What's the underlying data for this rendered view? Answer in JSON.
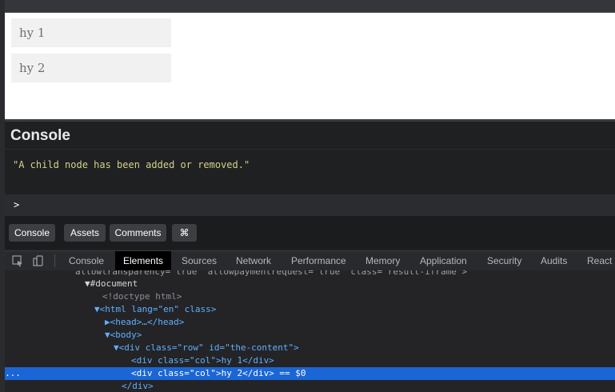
{
  "preview": {
    "cols": [
      "hy 1",
      "hy 2"
    ]
  },
  "console": {
    "title": "Console",
    "message": "\"A child node has been added or removed.\"",
    "prompt": ">"
  },
  "buttons": {
    "console": "Console",
    "assets": "Assets",
    "comments": "Comments",
    "cmd": "⌘"
  },
  "devtools": {
    "tabs": [
      "Console",
      "Elements",
      "Sources",
      "Network",
      "Performance",
      "Memory",
      "Application",
      "Security",
      "Audits",
      "React"
    ],
    "active_tab": "Elements"
  },
  "elements_tree": {
    "line0": "allowtransparency=\"true\" allowpaymentrequest=\"true\" class=\"result-iframe\">",
    "document": "▼#document",
    "doctype": "<!doctype html>",
    "html_open": "▼<html lang=\"en\" class>",
    "head": "▶<head>…</head>",
    "body_open": "▼<body>",
    "div_row": "▼<div class=\"row\" id=\"the-content\">",
    "col1": "<div class=\"col\">hy 1</div>",
    "col2": "<div class=\"col\">hy 2</div> == $0",
    "div_close": "</div>",
    "gutter_dots": "..."
  },
  "colors": {
    "accent_selected": "#1a66d6",
    "console_string": "#d7d08a",
    "tag": "#5eb0ff",
    "attr_value": "#f29d64"
  }
}
